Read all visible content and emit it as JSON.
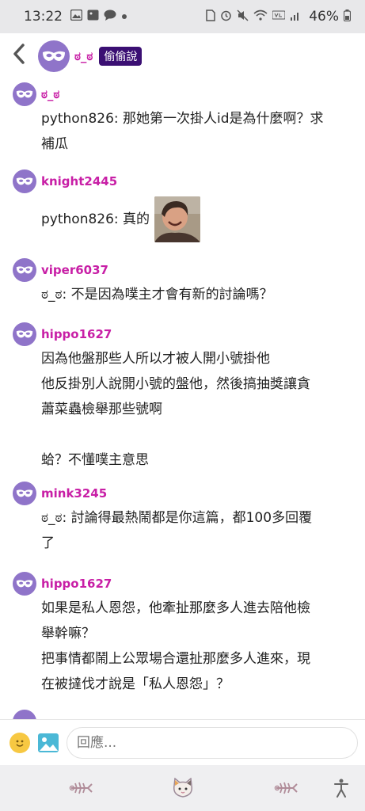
{
  "status_bar": {
    "time": "13:22",
    "battery": "46%",
    "left_icons": [
      "image-icon",
      "image-icon",
      "chat-icon",
      "dot-icon"
    ],
    "right_icons": [
      "sim-icon",
      "alarm-icon",
      "mute-icon",
      "wifi-icon",
      "volte-icon",
      "signal-icon",
      "battery-icon"
    ]
  },
  "header": {
    "back_icon": "chevron-left-icon",
    "name": "ಠ_ಠ",
    "badge": "偷偷說"
  },
  "comments": [
    {
      "user": "ಠ_ಠ",
      "lines": [
        "python826: 那她第一次掛人id是為什麼啊？求",
        "補瓜"
      ]
    },
    {
      "user": "knight2445",
      "lines": [
        "python826: 真的"
      ],
      "has_image": true
    },
    {
      "user": "viper6037",
      "lines": [
        "ಠ_ಠ: 不是因為噗主才會有新的討論嗎？"
      ]
    },
    {
      "user": "hippo1627",
      "lines": [
        "因為他盤那些人所以才被人開小號掛他",
        "他反掛別人說開小號的盤他，然後搞抽獎讓貪",
        "蕭菜蟲檢舉那些號啊",
        "",
        "蛤？不懂噗主意思"
      ]
    },
    {
      "user": "mink3245",
      "lines": [
        "ಠ_ಠ: 討論得最熱鬧都是你這篇，都100多回覆",
        "了"
      ]
    },
    {
      "user": "hippo1627",
      "lines": [
        "如果是私人恩怨，他牽扯那麼多人進去陪他檢",
        "舉幹嘛？",
        "把事情都鬧上公眾場合還扯那麼多人進來，現",
        "在被撻伐才說是「私人恩怨」？"
      ]
    }
  ],
  "input": {
    "placeholder": "回應...",
    "emoji_icon": "smiley-icon",
    "image_icon": "image-upload-icon"
  },
  "bottom_nav": [
    "fishbone-icon",
    "cat-face-icon",
    "fishbone-icon",
    "accessibility-icon"
  ],
  "colors": {
    "username": "#c81fa6",
    "badge_bg": "#3b0f73",
    "avatar_bg": "#8f74c9",
    "status_bar_bg": "#e8e8ea",
    "nav_bg": "#efeff1"
  }
}
